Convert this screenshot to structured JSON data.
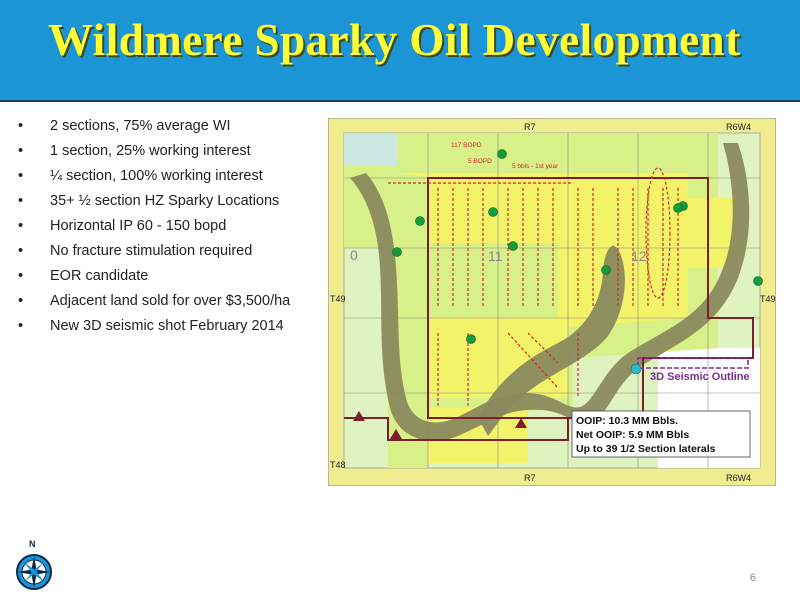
{
  "title": "Wildmere Sparky Oil Development",
  "bullets": [
    "2 sections, 75% average WI",
    "1 section, 25% working interest",
    "¼ section, 100% working interest",
    "35+ ½ section HZ Sparky Locations",
    "Horizontal IP 60 - 150 bopd",
    "No fracture stimulation required",
    "EOR candidate",
    "Adjacent land sold for over $3,500/ha",
    "New 3D seismic shot February 2014"
  ],
  "bullet_symbol": "•",
  "map": {
    "range_top": "R7",
    "range_top_right": "R6W4",
    "range_bottom": "R7",
    "range_bottom_right": "R6W4",
    "township_left": "T49",
    "township_right": "T49",
    "township_bottom_left": "T48",
    "section_left": "0",
    "section_mid": "11",
    "section_right": "12",
    "seismic_label": "3D Seismic Outline",
    "well_annotation_1": "117 BOPD",
    "well_annotation_2": "5 BOPD",
    "well_annotation_3": "5 bbls - 1st year",
    "info_box": [
      "OOIP: 10.3 MM Bbls.",
      "Net OOIP: 5.9 MM Bbls",
      "Up to 39 1/2 Section laterals"
    ],
    "colors": {
      "yellow_land": "#f3f36a",
      "lime_land": "#d7f087",
      "pale_land": "#dff3c0",
      "channel": "#8a8a5e",
      "frame": "#f0ec90",
      "lease_outline": "#7a1f2b",
      "seismic_outline": "#8a2c9a",
      "laterals": "#d8282a",
      "wells": "#169b3c"
    }
  },
  "compass_letter": "N",
  "page_number": "6"
}
